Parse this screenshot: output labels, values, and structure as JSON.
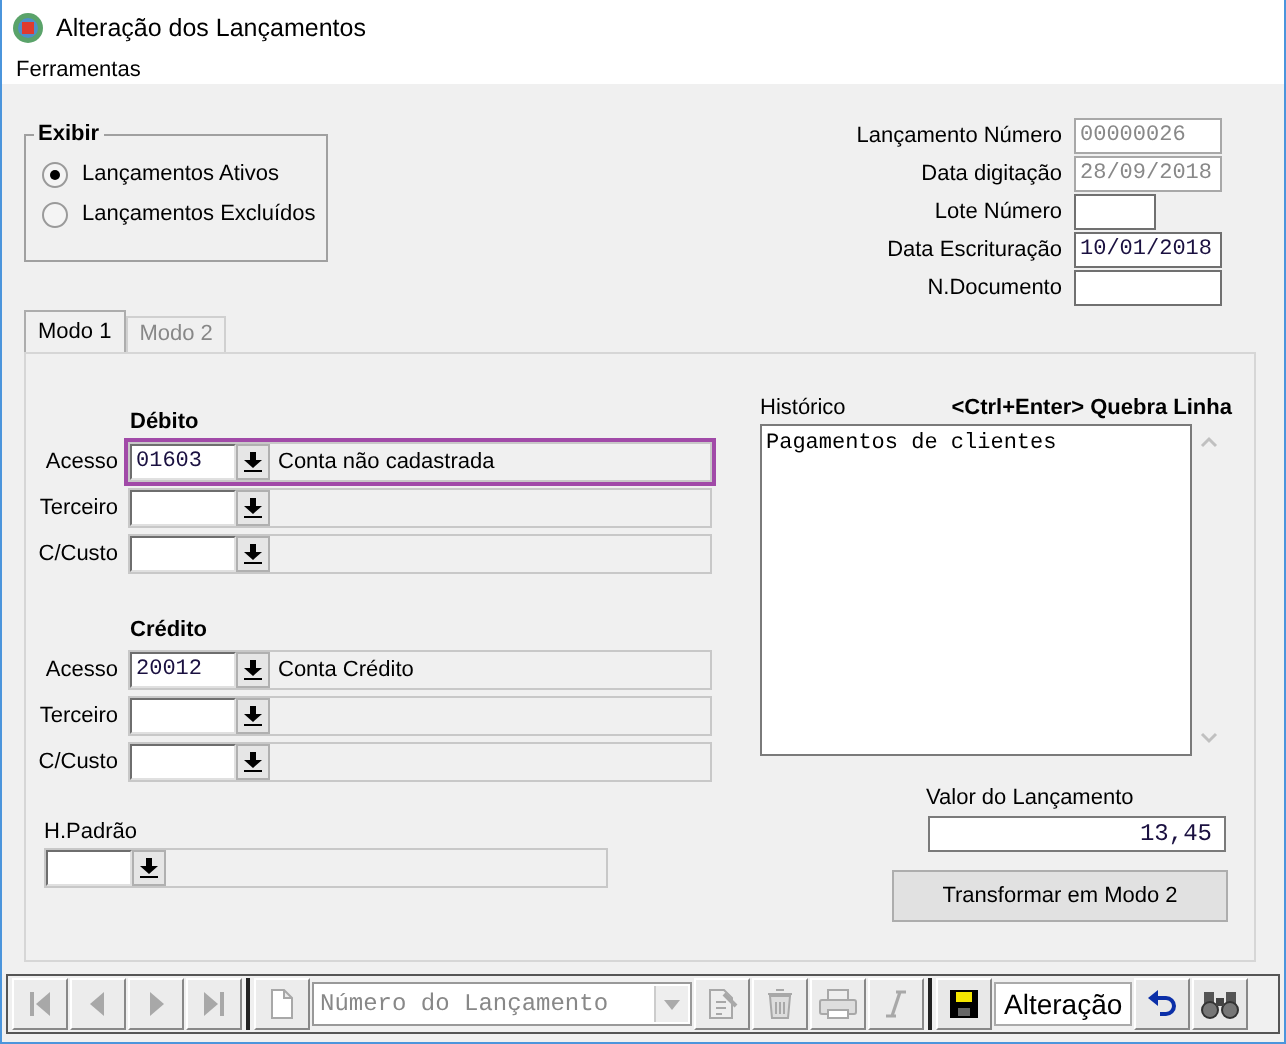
{
  "window": {
    "title": "Alteração dos Lançamentos"
  },
  "menu": [
    {
      "label": "Ferramentas"
    }
  ],
  "exibir": {
    "title": "Exibir",
    "options": [
      {
        "label": "Lançamentos Ativos",
        "selected": true
      },
      {
        "label": "Lançamentos Excluídos",
        "selected": false
      }
    ]
  },
  "header_fields": [
    {
      "label": "Lançamento Número",
      "value": "00000026",
      "disabled": true
    },
    {
      "label": "Data digitação",
      "value": "28/09/2018",
      "disabled": true
    },
    {
      "label": "Lote Número",
      "disabled": false
    },
    {
      "label": "Data Escrituração",
      "value": "10/01/2018",
      "disabled": false
    },
    {
      "label": "N.Documento",
      "disabled": false
    }
  ],
  "tabs": [
    {
      "label": "Modo 1",
      "selected": true
    },
    {
      "label": "Modo 2",
      "selected": false
    }
  ],
  "debito": {
    "title": "Débito",
    "rows": [
      {
        "label": "Acesso",
        "code": "01603",
        "description": "Conta não cadastrada",
        "highlighted": true
      },
      {
        "label": "Terceiro",
        "highlighted": false
      },
      {
        "label": "C/Custo",
        "highlighted": false
      }
    ]
  },
  "credito": {
    "title": "Crédito",
    "rows": [
      {
        "label": "Acesso",
        "code": "20012",
        "description": "Conta Crédito",
        "highlighted": false
      },
      {
        "label": "Terceiro",
        "highlighted": false
      },
      {
        "label": "C/Custo",
        "highlighted": false
      }
    ]
  },
  "h_padrao": {
    "label": "H.Padrão"
  },
  "historico": {
    "label": "Histórico",
    "hint": "<Ctrl+Enter> Quebra Linha",
    "value": "Pagamentos de clientes"
  },
  "valor": {
    "label": "Valor do Lançamento",
    "value": "13,45"
  },
  "transform_button": {
    "label": "Transformar em Modo 2"
  },
  "toolbar": {
    "groups": [
      [
        {
          "kind": "first",
          "disabled": true
        },
        {
          "kind": "prev",
          "disabled": true
        },
        {
          "kind": "next",
          "disabled": true
        },
        {
          "kind": "last",
          "disabled": true
        }
      ],
      [
        {
          "kind": "new",
          "disabled": true
        },
        {
          "kind": "combo",
          "placeholder": "Número do Lançamento",
          "disabled": true
        },
        {
          "kind": "export",
          "disabled": true
        },
        {
          "kind": "recycle",
          "disabled": true
        },
        {
          "kind": "print",
          "disabled": true
        },
        {
          "kind": "italic",
          "disabled": true
        }
      ],
      [
        {
          "kind": "save",
          "disabled": false
        },
        {
          "kind": "status",
          "text": "Alteração"
        },
        {
          "kind": "undo",
          "disabled": false
        },
        {
          "kind": "find",
          "disabled": false
        }
      ]
    ]
  }
}
